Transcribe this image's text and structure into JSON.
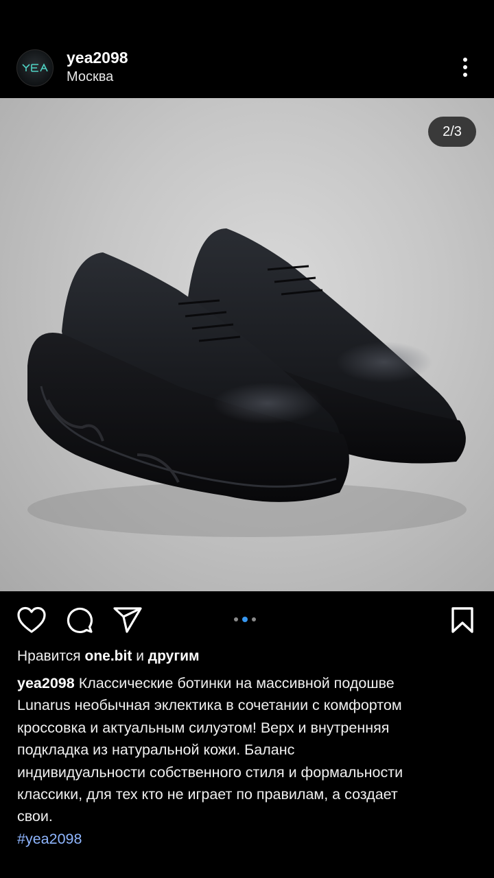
{
  "post": {
    "username": "yea2098",
    "location": "Москва",
    "avatar_text": "YEA",
    "slide_counter": "2/3",
    "carousel": {
      "total": 3,
      "active_index": 1
    }
  },
  "likes": {
    "prefix": "Нравится",
    "user": "one.bit",
    "and": "и",
    "others": "другим"
  },
  "caption": {
    "author": "yea2098",
    "lines": [
      "Классические ботинки на массивной подошве",
      "Lunarus необычная эклектика в сочетании с комфортом",
      "кроссовка и актуальным силуэтом!  Верх и внутренняя",
      "подкладка из натуральной кожи. Баланс",
      "индивидуальности собственного стиля и формальности",
      "классики, для тех кто не играет по правилам, а создает",
      "свои."
    ],
    "hashtag": "#yea2098"
  },
  "icons": {
    "more": "more-vertical-icon",
    "like": "heart-icon",
    "comment": "comment-icon",
    "share": "send-icon",
    "save": "bookmark-icon"
  },
  "colors": {
    "background": "#000000",
    "active_dot": "#3797f0",
    "inactive_dot": "#8a8a8a"
  }
}
